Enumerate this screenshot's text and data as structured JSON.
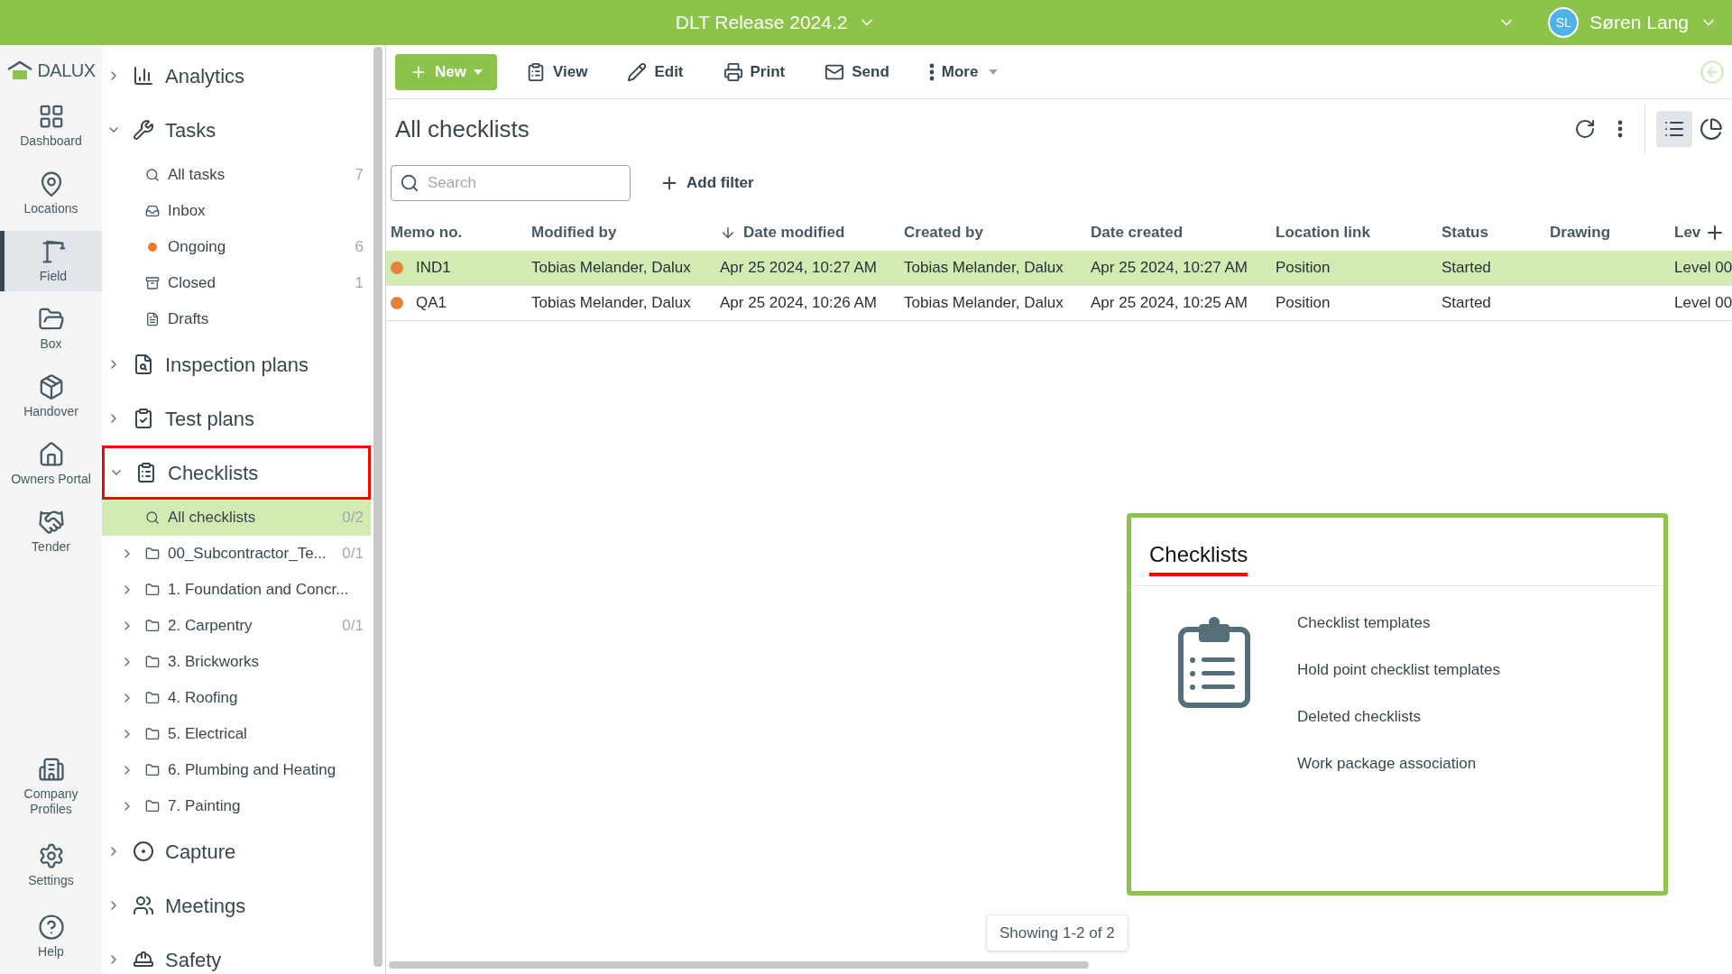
{
  "topbar": {
    "title": "DLT Release 2024.2",
    "user": {
      "initials": "SL",
      "name": "Søren Lang"
    }
  },
  "rail": {
    "logo": "DALUX",
    "items": [
      {
        "kind": "dashboard",
        "label": "Dashboard",
        "selected": false
      },
      {
        "kind": "locations",
        "label": "Locations",
        "selected": false
      },
      {
        "kind": "field",
        "label": "Field",
        "selected": true
      },
      {
        "kind": "box",
        "label": "Box",
        "selected": false
      },
      {
        "kind": "handover",
        "label": "Handover",
        "selected": false
      },
      {
        "kind": "owners",
        "label": "Owners Portal",
        "selected": false
      },
      {
        "kind": "tender",
        "label": "Tender",
        "selected": false
      }
    ],
    "footer_items": [
      {
        "kind": "company",
        "label": "Company Profiles",
        "selected": false
      },
      {
        "kind": "settings",
        "label": "Settings",
        "selected": false
      },
      {
        "kind": "help",
        "label": "Help",
        "selected": false
      }
    ]
  },
  "nav": {
    "sections": [
      {
        "kind": "analytics",
        "label": "Analytics",
        "expanded": false,
        "highlighted": false
      },
      {
        "kind": "tasks",
        "label": "Tasks",
        "expanded": true,
        "highlighted": false,
        "children": [
          {
            "kind": "search",
            "label": "All tasks",
            "count": "7",
            "selected": false
          },
          {
            "kind": "inbox",
            "label": "Inbox",
            "selected": false
          },
          {
            "kind": "status",
            "label": "Ongoing",
            "count": "6",
            "color": "#f07a2a",
            "selected": false
          },
          {
            "kind": "archive",
            "label": "Closed",
            "count": "1",
            "selected": false
          },
          {
            "kind": "draft",
            "label": "Drafts",
            "selected": false
          }
        ]
      },
      {
        "kind": "inspection",
        "label": "Inspection plans",
        "expanded": false,
        "highlighted": false
      },
      {
        "kind": "test",
        "label": "Test plans",
        "expanded": false,
        "highlighted": false
      },
      {
        "kind": "checklists",
        "label": "Checklists",
        "expanded": true,
        "highlighted": true,
        "children": [
          {
            "kind": "search",
            "label": "All checklists",
            "count": "0/2",
            "selected": true
          },
          {
            "kind": "folder",
            "label": "00_Subcontractor_Te...",
            "count": "0/1",
            "selected": false,
            "expanded": false
          },
          {
            "kind": "folder",
            "label": "1. Foundation and Concr...",
            "selected": false,
            "expanded": false
          },
          {
            "kind": "folder",
            "label": "2. Carpentry",
            "count": "0/1",
            "selected": false,
            "expanded": false
          },
          {
            "kind": "folder",
            "label": "3. Brickworks",
            "selected": false,
            "expanded": false
          },
          {
            "kind": "folder",
            "label": "4. Roofing",
            "selected": false,
            "expanded": false
          },
          {
            "kind": "folder",
            "label": "5. Electrical",
            "selected": false,
            "expanded": false
          },
          {
            "kind": "folder",
            "label": "6. Plumbing and Heating",
            "selected": false,
            "expanded": false
          },
          {
            "kind": "folder",
            "label": "7. Painting",
            "selected": false,
            "expanded": false
          }
        ]
      },
      {
        "kind": "capture",
        "label": "Capture",
        "expanded": false,
        "highlighted": false
      },
      {
        "kind": "meetings",
        "label": "Meetings",
        "expanded": false,
        "highlighted": false
      },
      {
        "kind": "safety",
        "label": "Safety",
        "expanded": false,
        "highlighted": false
      }
    ]
  },
  "toolbar": {
    "buttons": [
      {
        "kind": "new",
        "label": "New"
      },
      {
        "kind": "view",
        "label": "View"
      },
      {
        "kind": "edit",
        "label": "Edit"
      },
      {
        "kind": "print",
        "label": "Print"
      },
      {
        "kind": "send",
        "label": "Send"
      },
      {
        "kind": "more",
        "label": "More"
      }
    ]
  },
  "list": {
    "title": "All checklists",
    "search": {
      "placeholder": "Search"
    },
    "add_filter": "Add filter",
    "columns": [
      {
        "label": "Memo no.",
        "sorted": false
      },
      {
        "label": "Modified by",
        "sorted": false
      },
      {
        "label": "Date modified",
        "sorted": true
      },
      {
        "label": "Created by",
        "sorted": false
      },
      {
        "label": "Date created",
        "sorted": false
      },
      {
        "label": "Location link",
        "sorted": false
      },
      {
        "label": "Status",
        "sorted": false
      },
      {
        "label": "Drawing",
        "sorted": false
      },
      {
        "label": "Lev",
        "sorted": false
      }
    ],
    "rows": [
      {
        "selected": true,
        "color": "#e8823a",
        "cells": [
          "IND1",
          "Tobias Melander, Dalux",
          "Apr 25 2024, 10:27 AM",
          "Tobias Melander, Dalux",
          "Apr 25 2024, 10:27 AM",
          "Position",
          "Started",
          "",
          "Level 00"
        ]
      },
      {
        "selected": false,
        "color": "#e8823a",
        "cells": [
          "QA1",
          "Tobias Melander, Dalux",
          "Apr 25 2024, 10:26 AM",
          "Tobias Melander, Dalux",
          "Apr 25 2024, 10:25 AM",
          "Position",
          "Started",
          "",
          "Level 00"
        ]
      }
    ],
    "footer": "Showing 1-2 of 2"
  },
  "panel": {
    "title": "Checklists",
    "highlighted": true,
    "links": [
      "Checklist templates",
      "Hold point checklist templates",
      "Deleted checklists",
      "Work package association"
    ]
  }
}
